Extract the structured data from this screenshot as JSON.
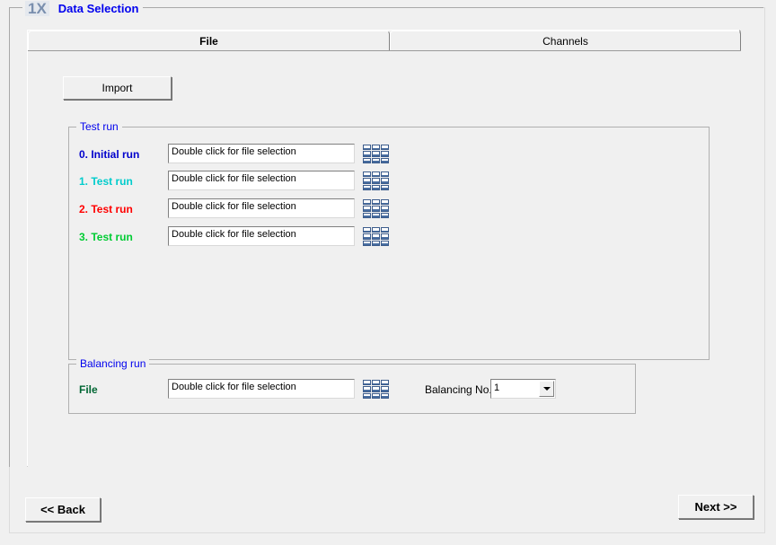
{
  "step": {
    "number": "1X",
    "title": "Data Selection"
  },
  "tabs": [
    {
      "id": "file",
      "label": "File",
      "active": true
    },
    {
      "id": "channels",
      "label": "Channels",
      "active": false
    }
  ],
  "toolbar": {
    "import_label": "Import"
  },
  "test_run_group": {
    "legend": "Test run",
    "rows": [
      {
        "label": "0.  Initial run",
        "color": "#0000cc",
        "value": "Double click for file selection",
        "icon": "table-grid-icon"
      },
      {
        "label": "1. Test run",
        "color": "#00cccc",
        "value": "Double click for file selection",
        "icon": "table-grid-icon"
      },
      {
        "label": "2. Test run",
        "color": "#ff0000",
        "value": "Double click for file selection",
        "icon": "table-grid-icon"
      },
      {
        "label": "3. Test run",
        "color": "#00cc33",
        "value": "Double click for file selection",
        "icon": "table-grid-icon"
      }
    ]
  },
  "balancing_group": {
    "legend": "Balancing run",
    "file_label": "File",
    "file_label_color": "#006633",
    "file_value": "Double click for file selection",
    "icon": "table-grid-icon",
    "balancing_no_label": "Balancing No.",
    "balancing_no_value": "1",
    "balancing_no_options": [
      "1"
    ]
  },
  "footer": {
    "back_label": "<< Back",
    "next_label": "Next >>"
  },
  "colors": {
    "window_background": "#f0f0f0",
    "title_accent": "#0000ee",
    "step_number": "#7a8fae",
    "legend": "#0000ee",
    "grid_icon_blue": "#486da0"
  }
}
